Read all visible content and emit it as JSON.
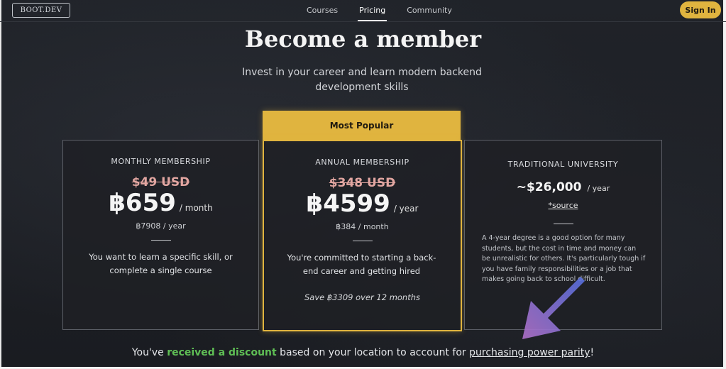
{
  "nav": {
    "logo": "BOOT.DEV",
    "links": [
      "Courses",
      "Pricing",
      "Community"
    ],
    "signin": "Sign In"
  },
  "hero": {
    "title": "Become a member",
    "subtitle": "Invest in your career and learn modern backend development skills"
  },
  "plans": {
    "monthly": {
      "title": "MONTHLY MEMBERSHIP",
      "old_price": "$49 USD",
      "price": "฿659",
      "per": "/ month",
      "sub": "฿7908 / year",
      "desc": "You want to learn a specific skill, or complete a single course"
    },
    "annual": {
      "badge": "Most Popular",
      "title": "ANNUAL MEMBERSHIP",
      "old_price": "$348 USD",
      "price": "฿4599",
      "per": "/ year",
      "sub": "฿384 / month",
      "desc": "You're committed to starting a back-end career and getting hired",
      "save": "Save ฿3309 over 12 months"
    },
    "university": {
      "title": "TRADITIONAL UNIVERSITY",
      "price": "~$26,000",
      "per": "/ year",
      "source": "*source",
      "desc": "A 4-year degree is a good option for many students, but the cost in time and money can be unrealistic for others. It's particularly tough if you have family responsibilities or a job that makes going back to school difficult."
    }
  },
  "footer": {
    "prefix": "You've ",
    "highlight": "received a discount",
    "middle": " based on your location to account for ",
    "link": "purchasing power parity",
    "suffix": "!"
  },
  "colors": {
    "accent": "#e0b43f",
    "discount": "#5fbf55",
    "arrow_start": "#4f6fe0",
    "arrow_end": "#b070c8"
  }
}
